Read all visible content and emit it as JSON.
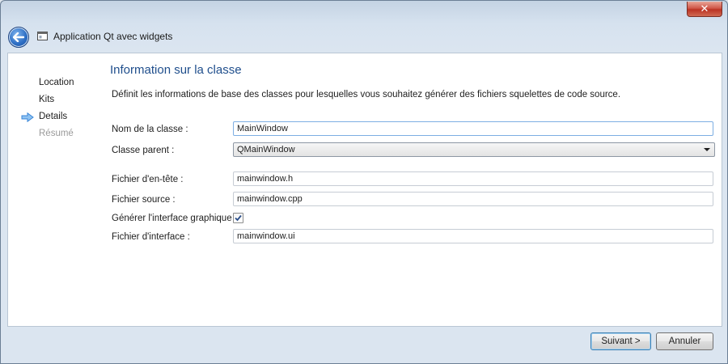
{
  "window": {
    "title": "Application Qt avec widgets",
    "close_glyph": "✕"
  },
  "sidebar": {
    "items": [
      {
        "label": "Location",
        "state": "done"
      },
      {
        "label": "Kits",
        "state": "done"
      },
      {
        "label": "Details",
        "state": "current"
      },
      {
        "label": "Résumé",
        "state": "pending"
      }
    ]
  },
  "page": {
    "title": "Information sur la classe",
    "description": "Définit les informations de base des classes pour lesquelles vous souhaitez générer des fichiers squelettes de code source."
  },
  "form": {
    "class_name": {
      "label": "Nom de la classe :",
      "value": "MainWindow"
    },
    "parent_class": {
      "label": "Classe parent :",
      "value": "QMainWindow"
    },
    "header_file": {
      "label": "Fichier d'en-tête :",
      "value": "mainwindow.h"
    },
    "source_file": {
      "label": "Fichier source :",
      "value": "mainwindow.cpp"
    },
    "generate_form": {
      "label": "Générer l'interface graphique :",
      "checked": true
    },
    "form_file": {
      "label": "Fichier d'interface :",
      "value": "mainwindow.ui"
    }
  },
  "buttons": {
    "next": "Suivant >",
    "cancel": "Annuler"
  },
  "colors": {
    "accent": "#1f4e8c",
    "arrow": "#3a86d8"
  }
}
